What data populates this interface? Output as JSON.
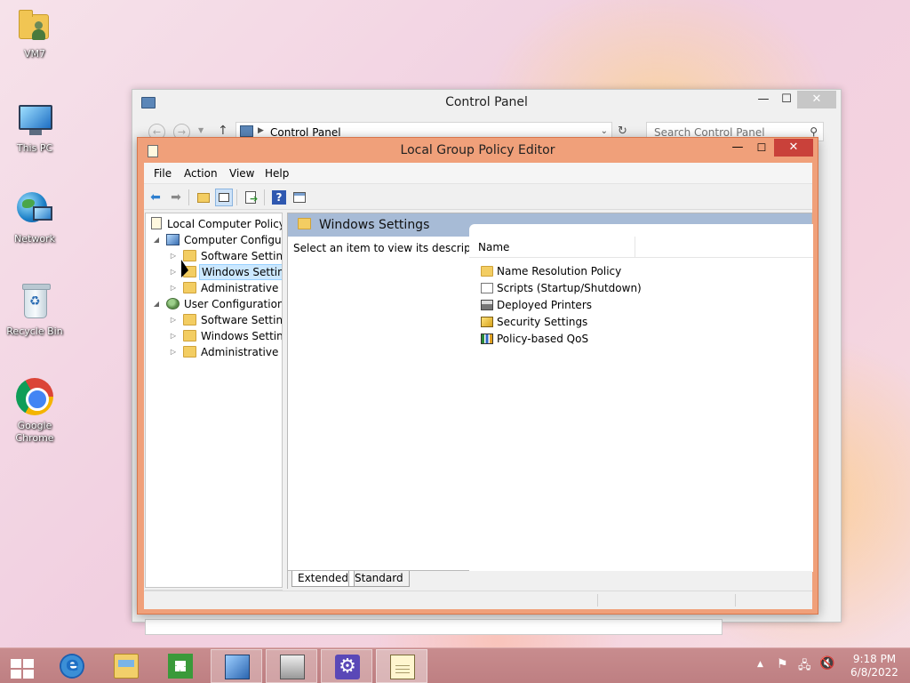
{
  "desktop": {
    "icons": [
      {
        "label": "VM7",
        "icon": "user-folder-icon"
      },
      {
        "label": "This PC",
        "icon": "computer-icon"
      },
      {
        "label": "Network",
        "icon": "network-icon"
      },
      {
        "label": "Recycle Bin",
        "icon": "recycle-bin-icon"
      },
      {
        "label": "Google Chrome",
        "icon": "chrome-icon"
      }
    ]
  },
  "control_panel": {
    "title": "Control Panel",
    "address": "Control Panel",
    "search_placeholder": "Search Control Panel",
    "minimize": "—",
    "maximize": "☐",
    "close": "✕"
  },
  "gpe": {
    "title": "Local Group Policy Editor",
    "minimize": "—",
    "maximize": "☐",
    "close": "✕",
    "menu": [
      "File",
      "Action",
      "View",
      "Help"
    ],
    "tree": [
      {
        "label": "Local Computer Policy"
      },
      {
        "label": "Computer Configura"
      },
      {
        "label": "Software Settings"
      },
      {
        "label": "Windows Setting"
      },
      {
        "label": "Administrative Te"
      },
      {
        "label": "User Configuration"
      },
      {
        "label": "Software Settings"
      },
      {
        "label": "Windows Setting"
      },
      {
        "label": "Administrative Te"
      }
    ],
    "selected_node": "Windows Setting",
    "content": {
      "header_title": "Windows Settings",
      "description": "Select an item to view its description.",
      "column_name": "Name",
      "items": [
        {
          "label": "Name Resolution Policy",
          "icon": "folder-icon"
        },
        {
          "label": "Scripts (Startup/Shutdown)",
          "icon": "script-icon"
        },
        {
          "label": "Deployed Printers",
          "icon": "printer-icon"
        },
        {
          "label": "Security Settings",
          "icon": "security-icon"
        },
        {
          "label": "Policy-based QoS",
          "icon": "qos-chart-icon"
        }
      ]
    },
    "tabs": [
      "Extended",
      "Standard"
    ],
    "active_tab": "Extended"
  },
  "taskbar": {
    "clock_time": "9:18 PM",
    "clock_date": "6/8/2022",
    "tray_chevron": "▲",
    "items": [
      "Internet Explorer",
      "File Explorer",
      "Store",
      "Control Panel",
      "Group Policy Management",
      "Settings",
      "Local Group Policy Editor"
    ]
  }
}
